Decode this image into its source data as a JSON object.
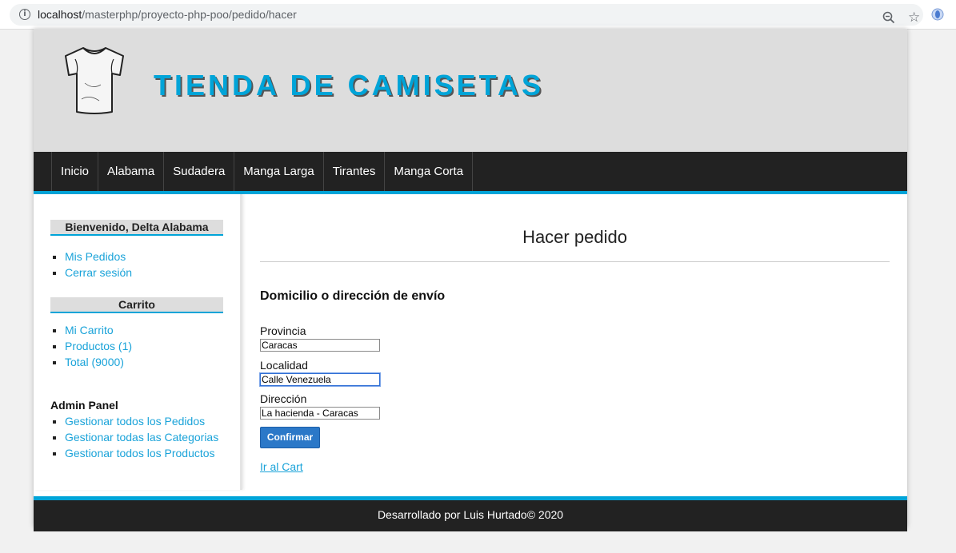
{
  "browser": {
    "url_host": "localhost",
    "url_path": "/masterphp/proyecto-php-poo/pedido/hacer"
  },
  "header": {
    "title": "TIENDA DE CAMISETAS"
  },
  "menu": {
    "items": [
      "Inicio",
      "Alabama",
      "Sudadera",
      "Manga Larga",
      "Tirantes",
      "Manga Corta"
    ]
  },
  "sidebar": {
    "welcome_title": "Bienvenido, Delta Alabama",
    "user_links": [
      "Mis Pedidos",
      "Cerrar sesión"
    ],
    "cart_title": "Carrito",
    "cart_links": [
      "Mi Carrito",
      "Productos (1)",
      "Total (9000)"
    ],
    "admin_title": "Admin Panel",
    "admin_links": [
      "Gestionar todos los Pedidos",
      "Gestionar todas las Categorias",
      "Gestionar todos los Productos"
    ]
  },
  "main": {
    "title": "Hacer pedido",
    "subtitle": "Domicilio o dirección de envío",
    "fields": [
      {
        "label": "Provincia",
        "value": "Caracas"
      },
      {
        "label": "Localidad",
        "value": "Calle Venezuela"
      },
      {
        "label": "Dirección",
        "value": "La hacienda - Caracas"
      }
    ],
    "confirm_label": "Confirmar",
    "cart_link": "Ir al Cart"
  },
  "footer": {
    "text": "Desarrollado por Luis Hurtado© 2020"
  },
  "colors": {
    "accent": "#00a4d8",
    "nav_bg": "#222222",
    "header_bg": "#dddddd",
    "button": "#2b78c8"
  }
}
